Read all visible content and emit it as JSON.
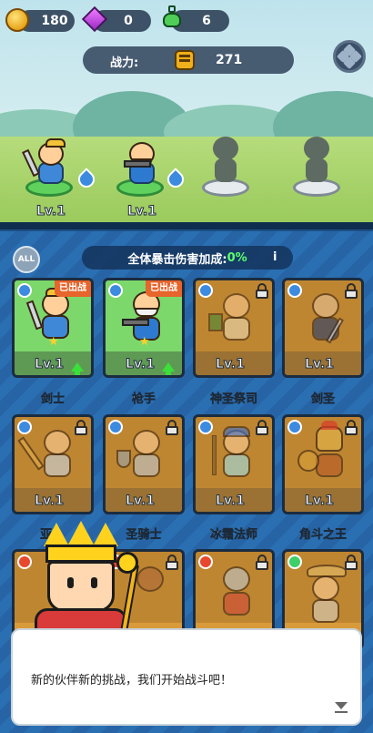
{
  "resources": [
    {
      "icon": "gold-coin-icon",
      "value": "180"
    },
    {
      "icon": "purple-gem-icon",
      "value": "0"
    },
    {
      "icon": "green-potion-icon",
      "value": "6"
    }
  ],
  "power": {
    "label": "战力:",
    "icon": "fist-icon",
    "value": "271"
  },
  "menu_icon": "diamond-grid-icon",
  "scene_heroes": [
    {
      "name": "swordsman",
      "level": "Lv.1",
      "element": "water"
    },
    {
      "name": "gunner",
      "level": "Lv.1",
      "element": "water"
    },
    {
      "name": "empty-slot",
      "level": ""
    },
    {
      "name": "empty-slot",
      "level": ""
    }
  ],
  "roster_header": {
    "all_label": "ALL",
    "crit_label": "全体暴击伤害加成:",
    "crit_value": "0%",
    "info_icon": "i"
  },
  "deployed_tag": "已出战",
  "cards": [
    {
      "name": "剑士",
      "level": "Lv.1",
      "element": "water",
      "deployed": true,
      "upgrade": true
    },
    {
      "name": "枪手",
      "level": "Lv.1",
      "element": "water",
      "deployed": true,
      "upgrade": true
    },
    {
      "name": "神圣祭司",
      "level": "Lv.1",
      "element": "water",
      "locked": true
    },
    {
      "name": "剑圣",
      "level": "Lv.1",
      "element": "water",
      "locked": true
    },
    {
      "name": "亚...",
      "level": "Lv.1",
      "element": "water",
      "locked": true
    },
    {
      "name": "圣骑士",
      "level": "Lv.1",
      "element": "water",
      "locked": true
    },
    {
      "name": "冰霜法师",
      "level": "Lv.1",
      "element": "water",
      "locked": true
    },
    {
      "name": "角斗之王",
      "level": "Lv.1",
      "element": "water",
      "locked": true
    },
    {
      "name": "",
      "level": "",
      "element": "fire",
      "locked": true
    },
    {
      "name": "",
      "level": "",
      "element": "fire",
      "locked": true
    },
    {
      "name": "",
      "level": "",
      "element": "fire",
      "locked": true
    },
    {
      "name": "",
      "level": "",
      "element": "wind",
      "locked": true
    }
  ],
  "dialog": {
    "speaker_icon": "king-icon",
    "text": "新的伙伴新的挑战，我们开始战斗吧！",
    "continue_icon": "down-arrow-icon"
  },
  "colors": {
    "deployed_card": "#7dd86c",
    "locked_card": "#d99a3a",
    "deployed_tag": "#e7642b",
    "crit_value": "#5dff6b",
    "panel_blue": "#2a6fb2"
  }
}
